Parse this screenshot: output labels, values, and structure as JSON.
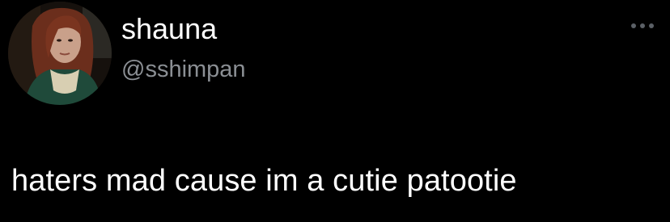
{
  "user": {
    "display_name": "shauna",
    "handle": "@sshimpan"
  },
  "tweet": {
    "text": "haters mad cause im a cutie patootie"
  },
  "icons": {
    "avatar": "profile-photo",
    "more": "more-options-icon"
  },
  "colors": {
    "background": "#000000",
    "primary_text": "#ffffff",
    "secondary_text": "#8b8f94",
    "icon": "#5b6066"
  }
}
